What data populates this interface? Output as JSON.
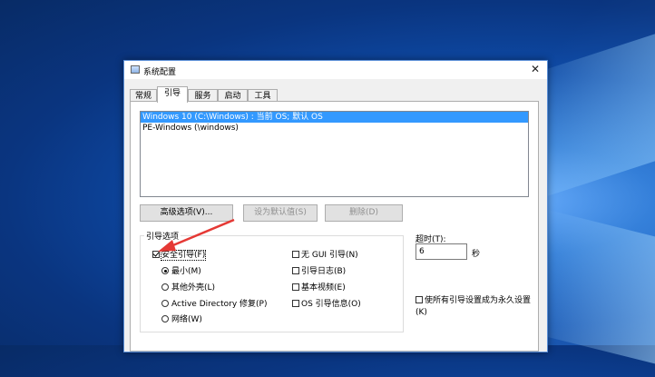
{
  "window": {
    "title": "系统配置",
    "close_glyph": "✕"
  },
  "tabs": [
    {
      "label": "常规",
      "active": false
    },
    {
      "label": "引导",
      "active": true
    },
    {
      "label": "服务",
      "active": false
    },
    {
      "label": "启动",
      "active": false
    },
    {
      "label": "工具",
      "active": false
    }
  ],
  "os_list": [
    {
      "text": "Windows 10 (C:\\Windows) : 当前 OS; 默认 OS",
      "selected": true
    },
    {
      "text": "PE-Windows (\\windows)",
      "selected": false
    }
  ],
  "buttons": {
    "advanced": "高级选项(V)...",
    "set_default": "设为默认值(S)",
    "delete": "删除(D)"
  },
  "boot_options": {
    "group_label": "引导选项",
    "safe_boot": {
      "label": "安全引导(F)",
      "checked": true
    },
    "radios": [
      {
        "label": "最小(M)",
        "selected": true
      },
      {
        "label": "其他外壳(L)",
        "selected": false
      },
      {
        "label": "Active Directory 修复(P)",
        "selected": false
      },
      {
        "label": "网络(W)",
        "selected": false
      }
    ],
    "checks": [
      {
        "label": "无 GUI 引导(N)",
        "checked": false
      },
      {
        "label": "引导日志(B)",
        "checked": false
      },
      {
        "label": "基本视频(E)",
        "checked": false
      },
      {
        "label": "OS 引导信息(O)",
        "checked": false
      }
    ]
  },
  "timeout": {
    "label": "超时(T):",
    "value": "6",
    "unit": "秒"
  },
  "permanent": {
    "label": "使所有引导设置成为永久设置(K)",
    "checked": false
  },
  "colors": {
    "selection": "#3399ff",
    "annotation_arrow": "#e53935"
  }
}
